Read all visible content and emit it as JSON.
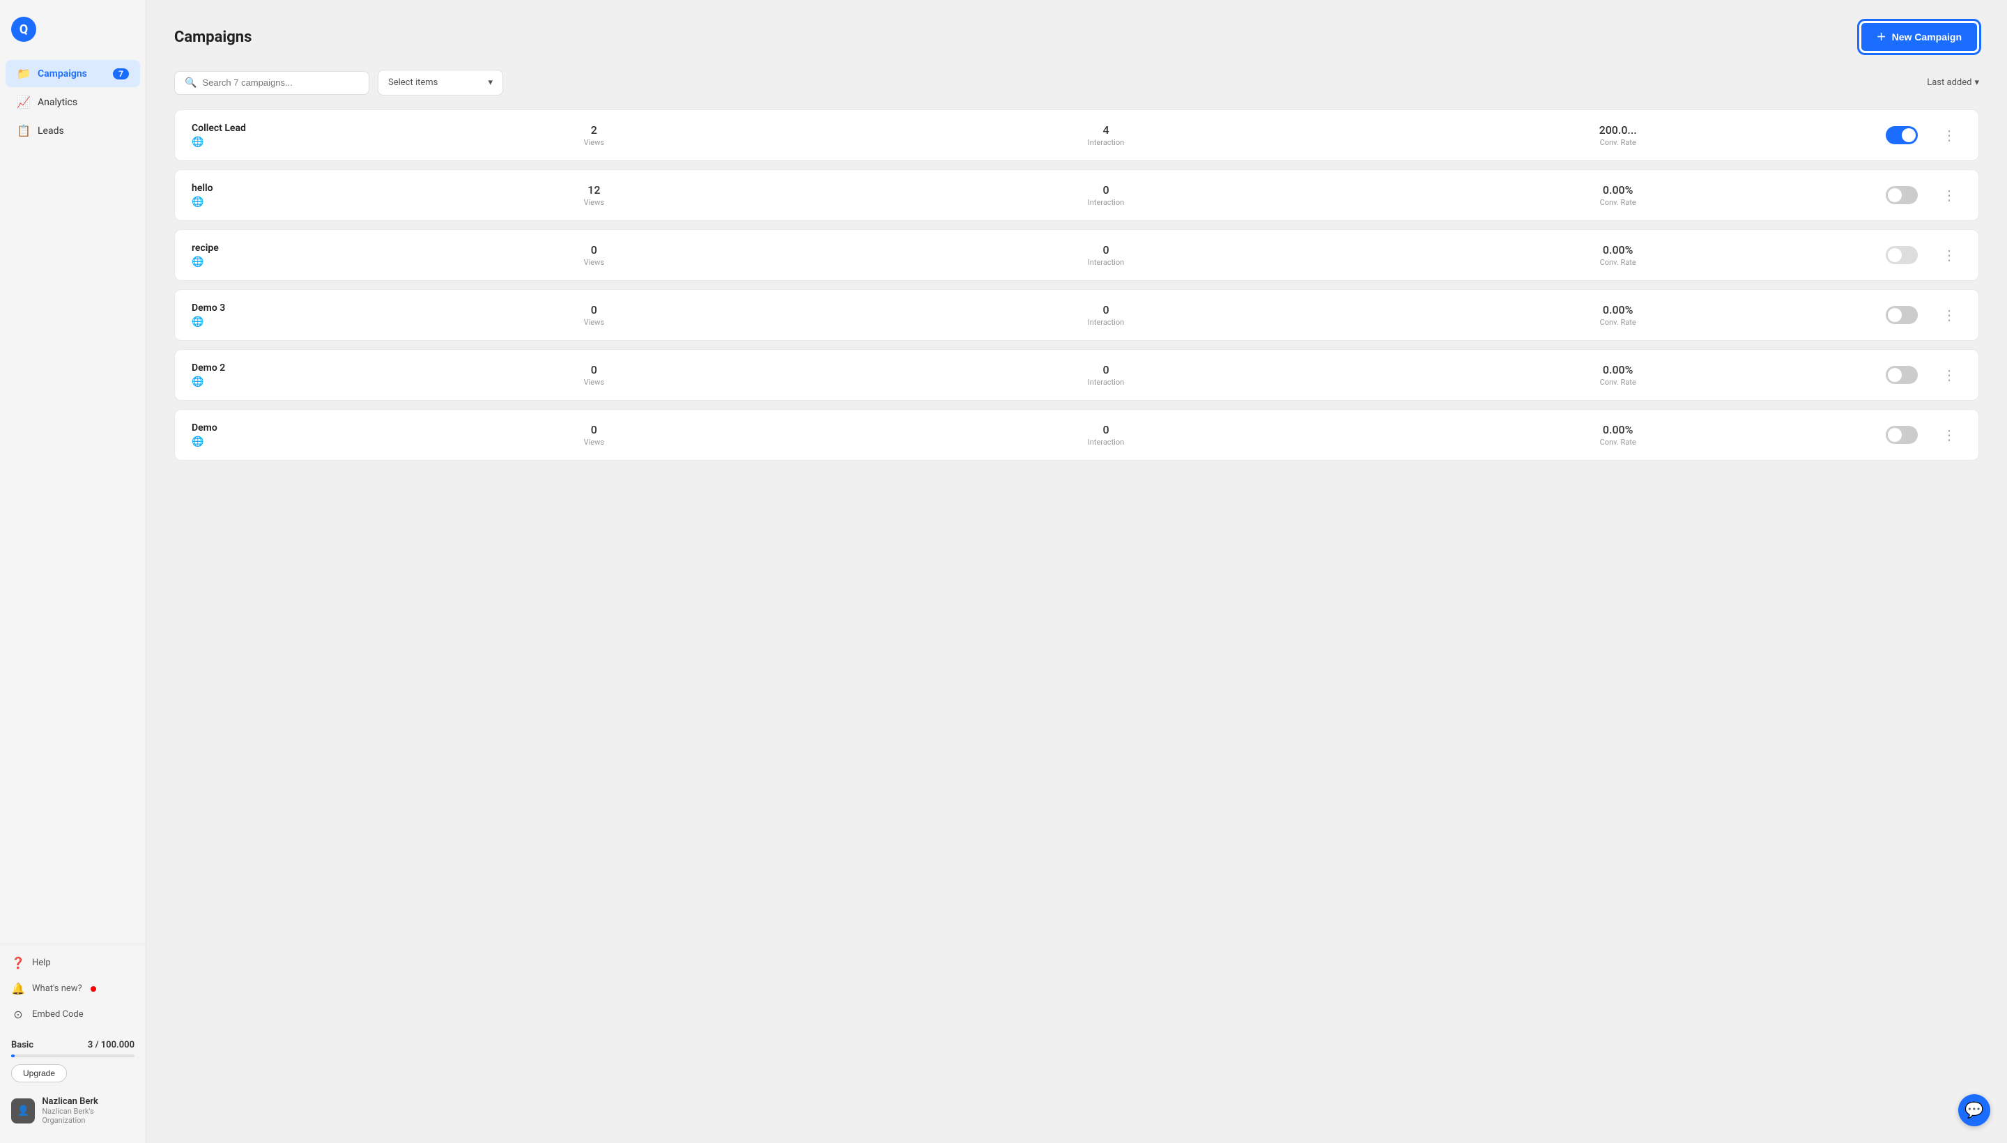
{
  "sidebar": {
    "logo": "Q",
    "nav_items": [
      {
        "id": "campaigns",
        "label": "Campaigns",
        "icon": "📁",
        "badge": "7",
        "active": true
      },
      {
        "id": "analytics",
        "label": "Analytics",
        "icon": "📈",
        "badge": null,
        "active": false
      },
      {
        "id": "leads",
        "label": "Leads",
        "icon": "📋",
        "badge": null,
        "active": false
      }
    ],
    "bottom_items": [
      {
        "id": "help",
        "label": "Help",
        "icon": "?"
      },
      {
        "id": "whats-new",
        "label": "What's new?",
        "icon": "🔔",
        "has_dot": true
      },
      {
        "id": "embed-code",
        "label": "Embed Code",
        "icon": "⊙"
      }
    ],
    "plan": {
      "name": "Basic",
      "usage": "3 / 100.000",
      "upgrade_label": "Upgrade"
    },
    "user": {
      "name": "Nazlican Berk",
      "org": "Nazlican Berk's Organization",
      "avatar_icon": "👤"
    }
  },
  "header": {
    "title": "Campaigns",
    "new_button_label": "New Campaign"
  },
  "filters": {
    "search_placeholder": "Search 7 campaigns...",
    "select_placeholder": "Select items",
    "sort_label": "Last added"
  },
  "campaigns": [
    {
      "name": "Collect Lead",
      "views": "2",
      "interaction": "4",
      "conv_rate": "200.0...",
      "toggle": "on"
    },
    {
      "name": "hello",
      "views": "12",
      "interaction": "0",
      "conv_rate": "0.00%",
      "toggle": "off"
    },
    {
      "name": "recipe",
      "views": "0",
      "interaction": "0",
      "conv_rate": "0.00%",
      "toggle": "disabled"
    },
    {
      "name": "Demo 3",
      "views": "0",
      "interaction": "0",
      "conv_rate": "0.00%",
      "toggle": "off"
    },
    {
      "name": "Demo 2",
      "views": "0",
      "interaction": "0",
      "conv_rate": "0.00%",
      "toggle": "off"
    },
    {
      "name": "Demo",
      "views": "0",
      "interaction": "0",
      "conv_rate": "0.00%",
      "toggle": "off"
    }
  ],
  "labels": {
    "views": "Views",
    "interaction": "Interaction",
    "conv_rate": "Conv. Rate"
  }
}
